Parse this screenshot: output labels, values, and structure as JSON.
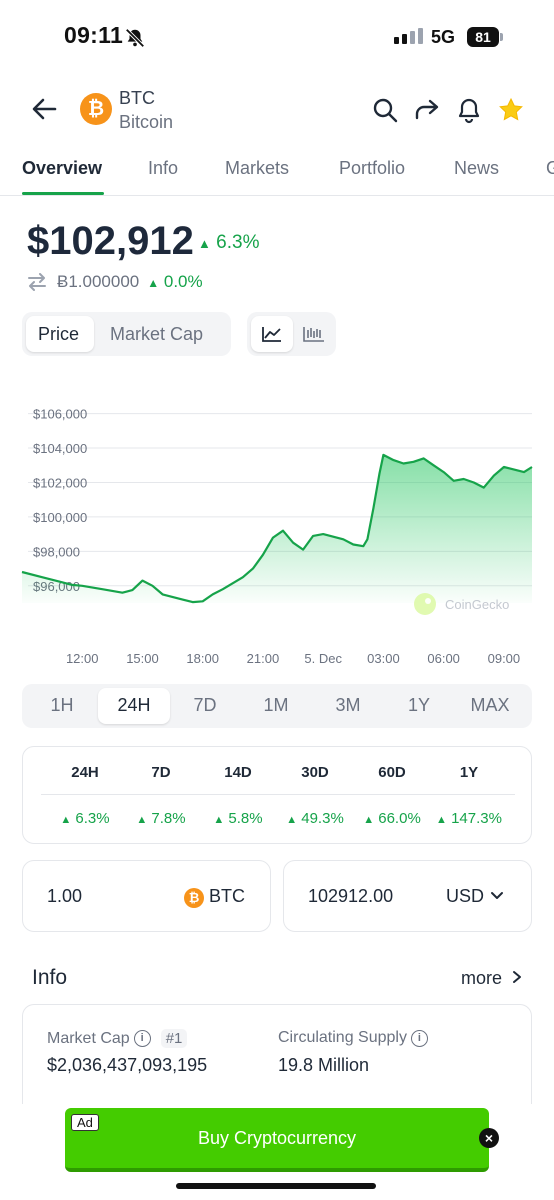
{
  "status_bar": {
    "time": "09:11",
    "network": "5G",
    "battery": "81"
  },
  "coin": {
    "symbol": "BTC",
    "name": "Bitcoin",
    "logo_glyph": "₿"
  },
  "tabs": [
    "Overview",
    "Info",
    "Markets",
    "Portfolio",
    "News",
    "G"
  ],
  "price": {
    "value": "$102,912",
    "change": "6.3%",
    "btc_value": "Ƀ1.000000",
    "btc_change": "0.0%"
  },
  "toggle": {
    "price": "Price",
    "market_cap": "Market Cap"
  },
  "ranges": [
    "1H",
    "24H",
    "7D",
    "1M",
    "3M",
    "1Y",
    "MAX"
  ],
  "active_range": "24H",
  "performance": [
    {
      "label": "24H",
      "value": "6.3%"
    },
    {
      "label": "7D",
      "value": "7.8%"
    },
    {
      "label": "14D",
      "value": "5.8%"
    },
    {
      "label": "30D",
      "value": "49.3%"
    },
    {
      "label": "60D",
      "value": "66.0%"
    },
    {
      "label": "1Y",
      "value": "147.3%"
    }
  ],
  "converter": {
    "amount": "1.00",
    "from": "BTC",
    "to_amount": "102912.00",
    "to": "USD"
  },
  "info": {
    "title": "Info",
    "more": "more",
    "market_cap_label": "Market Cap",
    "market_cap_rank": "#1",
    "market_cap_value": "$2,036,437,093,195",
    "supply_label": "Circulating Supply",
    "supply_value": "19.8 Million"
  },
  "ad": {
    "tag": "Ad",
    "text": "Buy Cryptocurrency"
  },
  "chart_data": {
    "type": "area",
    "watermark": "CoinGecko",
    "y_tick_labels": [
      "$106,000",
      "$104,000",
      "$102,000",
      "$100,000",
      "$98,000",
      "$96,000"
    ],
    "y_ticks": [
      106000,
      104000,
      102000,
      100000,
      98000,
      96000
    ],
    "ylim": [
      95000,
      106500
    ],
    "x_tick_labels": [
      "12:00",
      "15:00",
      "18:00",
      "21:00",
      "5. Dec",
      "03:00",
      "06:00",
      "09:00"
    ],
    "x_ticks": [
      2,
      5,
      8,
      11,
      14,
      17,
      20,
      23
    ],
    "xlim": [
      -1,
      24.4
    ],
    "line_color": "#16a34a",
    "series": [
      {
        "x": [
          -1,
          0,
          1,
          1.5,
          2,
          3,
          4,
          4.5,
          5,
          5.5,
          6,
          7,
          7.5,
          8,
          8.5,
          9,
          10,
          10.5,
          11,
          11.5,
          12,
          12.5,
          13,
          13.5,
          14,
          15,
          15.5,
          16,
          16.2,
          16.5,
          16.8,
          17,
          17.5,
          18,
          18.5,
          19,
          19.5,
          20,
          20.5,
          21,
          21.5,
          22,
          22.5,
          23,
          24,
          24.4
        ],
        "y": [
          96800,
          96500,
          96200,
          96050,
          96000,
          95800,
          95600,
          95750,
          96300,
          96000,
          95500,
          95200,
          95050,
          95100,
          95500,
          95800,
          96500,
          97000,
          97800,
          98800,
          99200,
          98500,
          98100,
          98900,
          99000,
          98700,
          98400,
          98300,
          98700,
          100500,
          102500,
          103600,
          103300,
          103100,
          103200,
          103400,
          103000,
          102600,
          102100,
          102200,
          102000,
          101700,
          102400,
          102900,
          102600,
          102900
        ]
      }
    ]
  }
}
